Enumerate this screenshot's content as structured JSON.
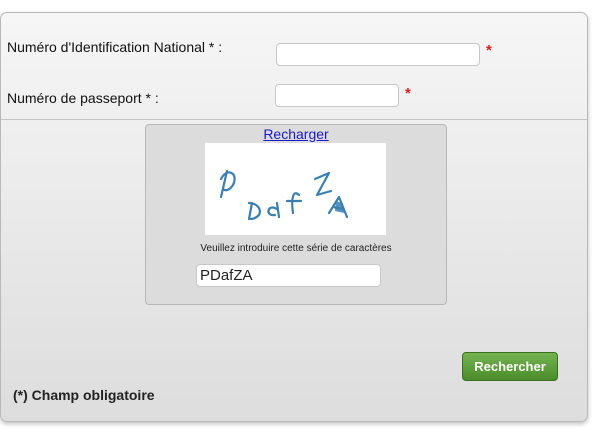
{
  "form": {
    "nin_label": "Numéro d'Identification National * :",
    "nin_value": "",
    "passport_label": "Numéro de passeport * :",
    "passport_value": "",
    "required_marker": "*"
  },
  "captcha": {
    "reload_label": "Recharger",
    "image_text": "PDafZA",
    "instruction": "Veuillez introduire cette série de caractères",
    "input_value": "PDafZA"
  },
  "actions": {
    "search_label": "Rechercher"
  },
  "footer": {
    "mandatory_note": "(*) Champ obligatoire"
  },
  "colors": {
    "required": "#d81e1e",
    "button": "#5a9a3a",
    "link": "#1a1ac8",
    "captcha_ink": "#3a7fb0"
  }
}
